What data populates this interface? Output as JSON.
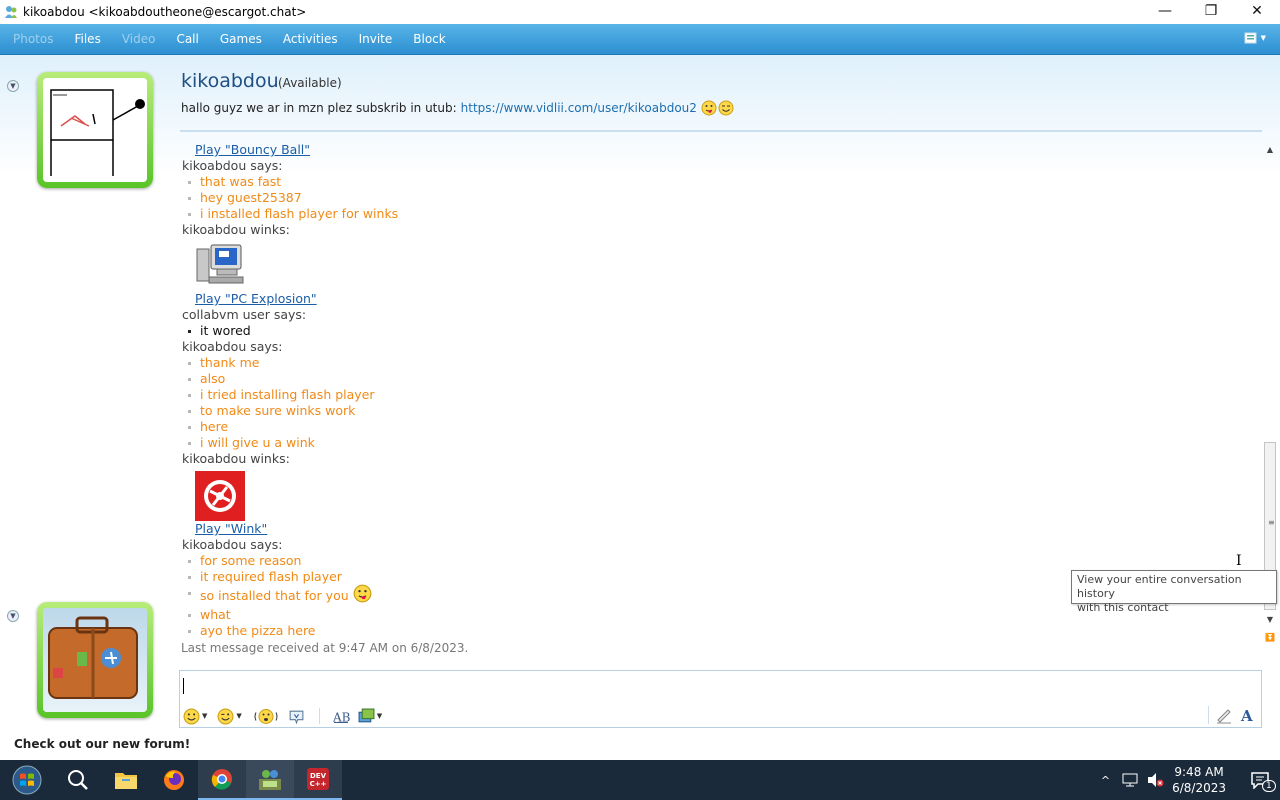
{
  "window": {
    "title": "kikoabdou <kikoabdoutheone@escargot.chat>",
    "minimize": "—",
    "restore": "❐",
    "close": "✕"
  },
  "toolbar": {
    "items": [
      "Photos",
      "Files",
      "Video",
      "Call",
      "Games",
      "Activities",
      "Invite",
      "Block"
    ]
  },
  "contact": {
    "name": "kikoabdou",
    "status": "(Available)",
    "psm_text": "hallo guyz we ar in mzn plez subskrib in utub:",
    "psm_link": "https://www.vidlii.com/user/kikoabdou2"
  },
  "conversation": {
    "play_bouncy": "Play \"Bouncy Ball\"",
    "says1": "kikoabdou says:",
    "m1": "that was fast",
    "m2": "hey guest25387",
    "m3": "i installed flash player for winks",
    "winks1": "kikoabdou winks:",
    "play_pc": "Play \"PC Explosion\"",
    "says2": "collabvm user says:",
    "m4": "it wored",
    "says3": "kikoabdou says:",
    "m5": "thank me",
    "m6": "also",
    "m7": "i tried installing flash player",
    "m8": "to make sure winks work",
    "m9": "here",
    "m10": "i will give u a wink",
    "winks2": "kikoabdou winks:",
    "play_wink": "Play \"Wink\"",
    "says4": "kikoabdou says:",
    "m11": "for some reason",
    "m12": "it required flash player",
    "m13": "so installed that for you",
    "m14": "what",
    "m15": "ayo the pizza here",
    "last_received": "Last message received at 9:47 AM on 6/8/2023."
  },
  "tooltip": {
    "line1": "View your entire conversation history",
    "line2": "with this contact"
  },
  "footer": {
    "forum": "Check out our new forum!"
  },
  "taskbar": {
    "time": "9:48 AM",
    "date": "6/8/2023",
    "notifications": "1"
  }
}
